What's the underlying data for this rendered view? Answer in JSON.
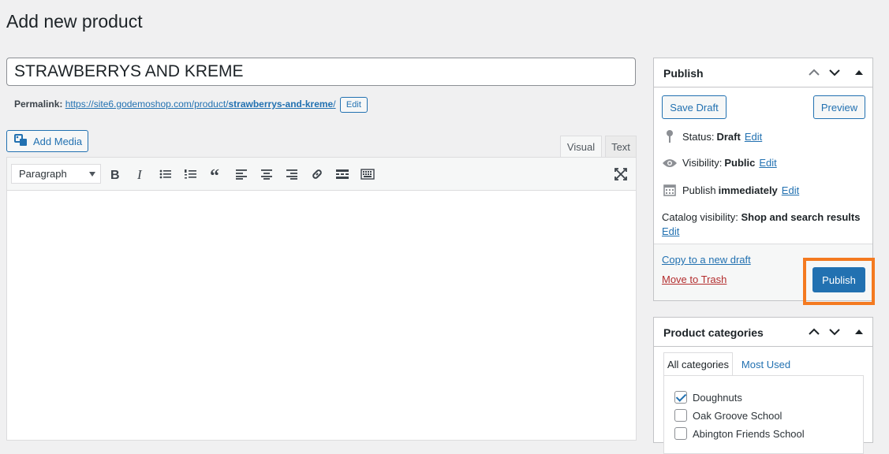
{
  "page": {
    "title": "Add new product"
  },
  "product": {
    "title_value": "STRAWBERRYS AND KREME",
    "permalink_label": "Permalink:",
    "permalink_base": "https://site6.godemoshop.com/product/",
    "permalink_slug": "strawberrys-and-kreme",
    "permalink_trail": "/",
    "permalink_edit": "Edit"
  },
  "editor": {
    "add_media": "Add Media",
    "tabs": {
      "visual": "Visual",
      "text": "Text"
    },
    "format_value": "Paragraph",
    "toolbar_icons": [
      "bold-icon",
      "italic-icon",
      "bullet-list-icon",
      "numbered-list-icon",
      "blockquote-icon",
      "align-left-icon",
      "align-center-icon",
      "align-right-icon",
      "link-icon",
      "read-more-icon",
      "toolbar-toggle-icon",
      "fullscreen-icon"
    ]
  },
  "publish": {
    "title": "Publish",
    "save_draft": "Save Draft",
    "preview": "Preview",
    "status_label": "Status:",
    "status_value": "Draft",
    "visibility_label": "Visibility:",
    "visibility_value": "Public",
    "publish_label": "Publish",
    "publish_value": "immediately",
    "edit": "Edit",
    "catalog_label": "Catalog visibility:",
    "catalog_value": "Shop and search results",
    "copy_draft": "Copy to a new draft",
    "move_trash": "Move to Trash",
    "publish_button": "Publish"
  },
  "categories": {
    "title": "Product categories",
    "tab_all": "All categories",
    "tab_used": "Most Used",
    "items": [
      {
        "label": "Doughnuts",
        "checked": true
      },
      {
        "label": "Oak Groove School",
        "checked": false
      },
      {
        "label": "Abington Friends School",
        "checked": false
      }
    ]
  },
  "colors": {
    "accent": "#2271b1",
    "highlight": "#f47a20",
    "trash": "#b32d2e"
  }
}
